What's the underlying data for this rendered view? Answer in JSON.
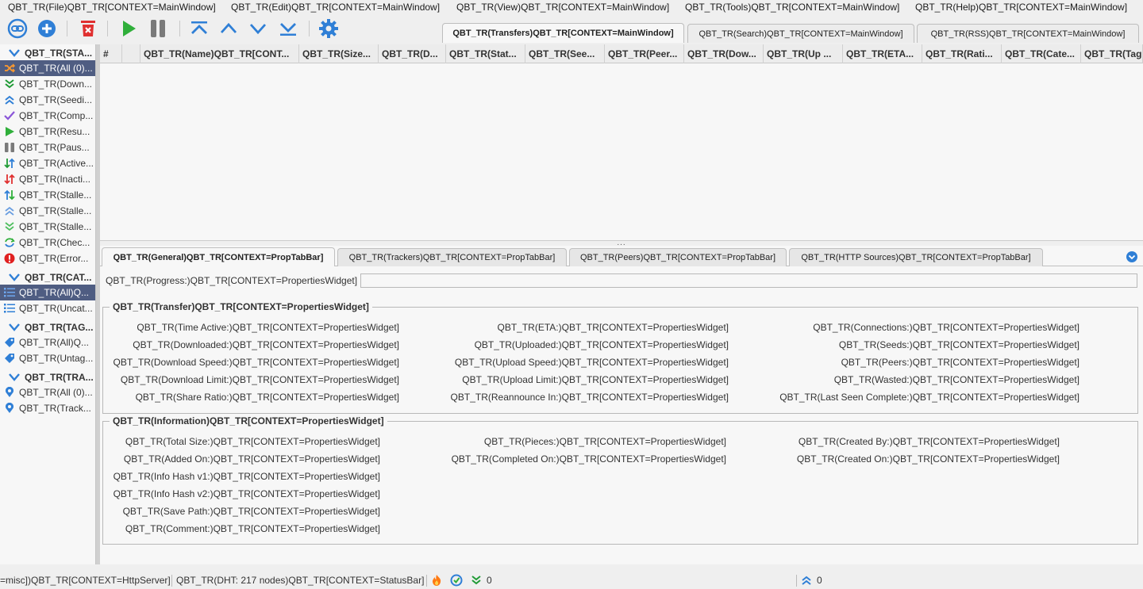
{
  "menu": [
    "QBT_TR(File)QBT_TR[CONTEXT=MainWindow]",
    "QBT_TR(Edit)QBT_TR[CONTEXT=MainWindow]",
    "QBT_TR(View)QBT_TR[CONTEXT=MainWindow]",
    "QBT_TR(Tools)QBT_TR[CONTEXT=MainWindow]",
    "QBT_TR(Help)QBT_TR[CONTEXT=MainWindow]"
  ],
  "toolbar": {
    "icons": [
      "add-link-icon",
      "add-torrent-icon",
      "delete-icon",
      "resume-icon",
      "pause-icon",
      "move-top-icon",
      "move-up-icon",
      "move-down-icon",
      "move-bottom-icon",
      "options-gear-icon"
    ],
    "colors": {
      "blue": "#2f7fd6",
      "red": "#e03030",
      "green": "#2faf3a",
      "gray": "#7a7a7a"
    }
  },
  "main_tabs": [
    "QBT_TR(Transfers)QBT_TR[CONTEXT=MainWindow]",
    "QBT_TR(Search)QBT_TR[CONTEXT=MainWindow]",
    "QBT_TR(RSS)QBT_TR[CONTEXT=MainWindow]"
  ],
  "sidebar": {
    "status_header": "QBT_TR(STA...",
    "status_items": [
      {
        "label": "QBT_TR(All (0)...",
        "icon": "shuffle-icon"
      },
      {
        "label": "QBT_TR(Down...",
        "icon": "downloading-icon"
      },
      {
        "label": "QBT_TR(Seedi...",
        "icon": "seeding-icon"
      },
      {
        "label": "QBT_TR(Comp...",
        "icon": "completed-check-icon"
      },
      {
        "label": "QBT_TR(Resu...",
        "icon": "resumed-play-icon"
      },
      {
        "label": "QBT_TR(Paus...",
        "icon": "paused-icon"
      },
      {
        "label": "QBT_TR(Active...",
        "icon": "active-arrows-icon"
      },
      {
        "label": "QBT_TR(Inacti...",
        "icon": "inactive-arrows-icon"
      },
      {
        "label": "QBT_TR(Stalle...",
        "icon": "stalled-arrows-icon"
      },
      {
        "label": "QBT_TR(Stalle...",
        "icon": "stalled-up-icon"
      },
      {
        "label": "QBT_TR(Stalle...",
        "icon": "stalled-down-icon"
      },
      {
        "label": "QBT_TR(Chec...",
        "icon": "checking-icon"
      },
      {
        "label": "QBT_TR(Error...",
        "icon": "error-icon"
      }
    ],
    "categories_header": "QBT_TR(CAT...",
    "category_items": [
      {
        "label": "QBT_TR(All)Q...",
        "icon": "list-icon"
      },
      {
        "label": "QBT_TR(Uncat...",
        "icon": "list-icon"
      }
    ],
    "tags_header": "QBT_TR(TAG...",
    "tag_items": [
      {
        "label": "QBT_TR(All)Q...",
        "icon": "tag-icon"
      },
      {
        "label": "QBT_TR(Untag...",
        "icon": "tag-icon"
      }
    ],
    "trackers_header": "QBT_TR(TRA...",
    "tracker_items": [
      {
        "label": "QBT_TR(All (0)...",
        "icon": "location-pin-icon"
      },
      {
        "label": "QBT_TR(Track...",
        "icon": "location-pin-icon"
      }
    ]
  },
  "columns": [
    "#",
    "",
    "QBT_TR(Name)QBT_TR[CONT...",
    "QBT_TR(Size...",
    "QBT_TR(D...",
    "QBT_TR(Stat...",
    "QBT_TR(See...",
    "QBT_TR(Peer...",
    "QBT_TR(Dow...",
    "QBT_TR(Up ...",
    "QBT_TR(ETA...",
    "QBT_TR(Rati...",
    "QBT_TR(Cate...",
    "QBT_TR(Tag"
  ],
  "splitter_grip": "...",
  "prop_tabs": [
    "QBT_TR(General)QBT_TR[CONTEXT=PropTabBar]",
    "QBT_TR(Trackers)QBT_TR[CONTEXT=PropTabBar]",
    "QBT_TR(Peers)QBT_TR[CONTEXT=PropTabBar]",
    "QBT_TR(HTTP Sources)QBT_TR[CONTEXT=PropTabBar]"
  ],
  "progress_label": "QBT_TR(Progress:)QBT_TR[CONTEXT=PropertiesWidget]",
  "transfer": {
    "title": "QBT_TR(Transfer)QBT_TR[CONTEXT=PropertiesWidget]",
    "col1": [
      "QBT_TR(Time Active:)QBT_TR[CONTEXT=PropertiesWidget]",
      "QBT_TR(Downloaded:)QBT_TR[CONTEXT=PropertiesWidget]",
      "QBT_TR(Download Speed:)QBT_TR[CONTEXT=PropertiesWidget]",
      "QBT_TR(Download Limit:)QBT_TR[CONTEXT=PropertiesWidget]",
      "QBT_TR(Share Ratio:)QBT_TR[CONTEXT=PropertiesWidget]"
    ],
    "col2": [
      "QBT_TR(ETA:)QBT_TR[CONTEXT=PropertiesWidget]",
      "QBT_TR(Uploaded:)QBT_TR[CONTEXT=PropertiesWidget]",
      "QBT_TR(Upload Speed:)QBT_TR[CONTEXT=PropertiesWidget]",
      "QBT_TR(Upload Limit:)QBT_TR[CONTEXT=PropertiesWidget]",
      "QBT_TR(Reannounce In:)QBT_TR[CONTEXT=PropertiesWidget]"
    ],
    "col3": [
      "QBT_TR(Connections:)QBT_TR[CONTEXT=PropertiesWidget]",
      "QBT_TR(Seeds:)QBT_TR[CONTEXT=PropertiesWidget]",
      "QBT_TR(Peers:)QBT_TR[CONTEXT=PropertiesWidget]",
      "QBT_TR(Wasted:)QBT_TR[CONTEXT=PropertiesWidget]",
      "QBT_TR(Last Seen Complete:)QBT_TR[CONTEXT=PropertiesWidget]"
    ]
  },
  "information": {
    "title": "QBT_TR(Information)QBT_TR[CONTEXT=PropertiesWidget]",
    "col1": [
      "QBT_TR(Total Size:)QBT_TR[CONTEXT=PropertiesWidget]",
      "QBT_TR(Added On:)QBT_TR[CONTEXT=PropertiesWidget]",
      "QBT_TR(Info Hash v1:)QBT_TR[CONTEXT=PropertiesWidget]",
      "QBT_TR(Info Hash v2:)QBT_TR[CONTEXT=PropertiesWidget]",
      "QBT_TR(Save Path:)QBT_TR[CONTEXT=PropertiesWidget]",
      "QBT_TR(Comment:)QBT_TR[CONTEXT=PropertiesWidget]"
    ],
    "col2": [
      "QBT_TR(Pieces:)QBT_TR[CONTEXT=PropertiesWidget]",
      "QBT_TR(Completed On:)QBT_TR[CONTEXT=PropertiesWidget]"
    ],
    "col3": [
      "QBT_TR(Created By:)QBT_TR[CONTEXT=PropertiesWidget]",
      "QBT_TR(Created On:)QBT_TR[CONTEXT=PropertiesWidget]"
    ]
  },
  "statusbar": {
    "http_server": "=misc])QBT_TR[CONTEXT=HttpServer]",
    "dht": "QBT_TR(DHT: 217 nodes)QBT_TR[CONTEXT=StatusBar]",
    "download_speed": "0",
    "upload_speed": "0"
  }
}
